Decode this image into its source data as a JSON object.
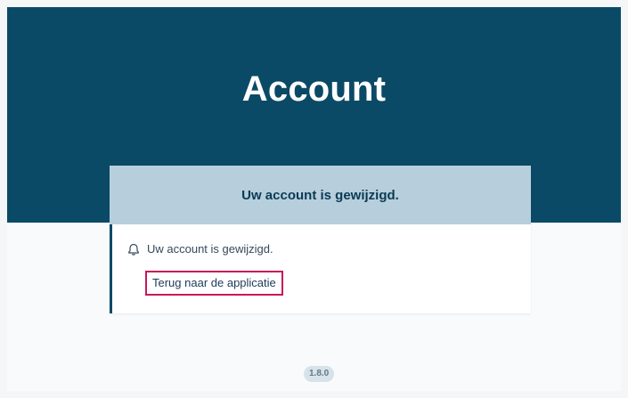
{
  "header": {
    "title": "Account"
  },
  "card": {
    "title": "Uw account is gewijzigd.",
    "message": "Uw account is gewijzigd.",
    "link_label": "Terug naar de applicatie"
  },
  "footer": {
    "version": "1.8.0"
  },
  "colors": {
    "header_bg": "#0b4a66",
    "card_header_bg": "#b7cfdc",
    "focus_outline": "#c8185a"
  },
  "icons": {
    "notice": "bell-icon"
  }
}
